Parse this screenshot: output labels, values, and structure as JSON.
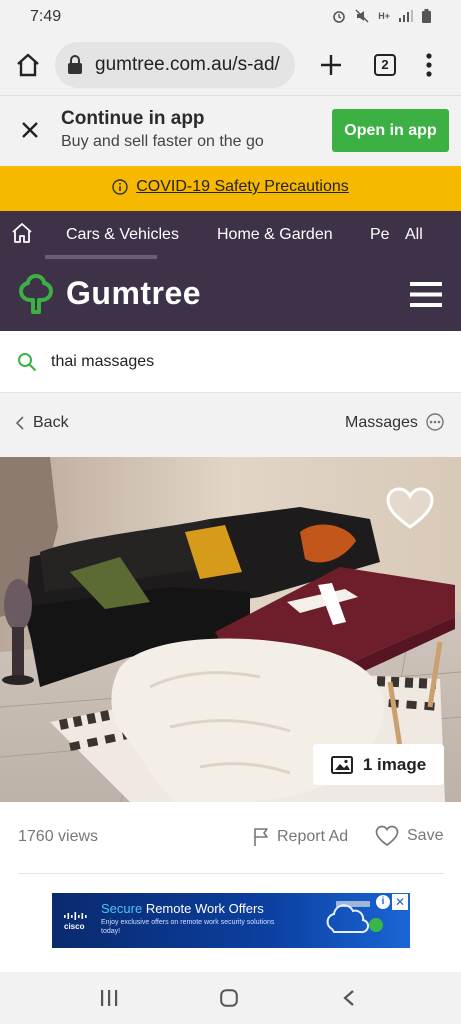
{
  "status_bar": {
    "time": "7:49",
    "network_label": "H+"
  },
  "browser": {
    "url": "gumtree.com.au/s-ad/",
    "tab_count": "2"
  },
  "app_banner": {
    "title": "Continue in app",
    "subtitle": "Buy and sell faster on the go",
    "button_label": "Open in app"
  },
  "covid": {
    "link_text": "COVID-19 Safety Precautions"
  },
  "category_nav": {
    "items": [
      {
        "label": "Cars & Vehicles"
      },
      {
        "label": "Home & Garden"
      },
      {
        "label": "Pe"
      }
    ],
    "all_label": "All"
  },
  "brand": {
    "name": "Gumtree"
  },
  "search": {
    "query": "thai massages"
  },
  "breadcrumb": {
    "back_label": "Back",
    "category_label": "Massages"
  },
  "listing": {
    "image_count_label": "1 image",
    "views": "1760 views",
    "report_label": "Report Ad",
    "save_label": "Save"
  },
  "ad": {
    "brand": "cisco",
    "title_highlight": "Secure",
    "title_rest": " Remote Work Offers",
    "description": "Enjoy exclusive offers on remote work security solutions today!"
  },
  "colors": {
    "brand_purple": "#3d3247",
    "accent_green": "#3cb043",
    "covid_yellow": "#f7b900"
  }
}
